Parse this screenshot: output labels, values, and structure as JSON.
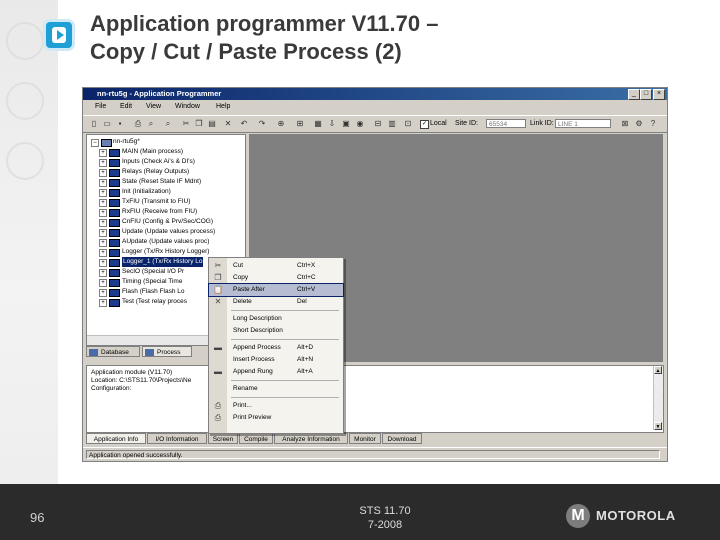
{
  "slide": {
    "title_line1": "Application programmer V11.70 –",
    "title_line2": "Copy / Cut / Paste Process (2)",
    "page_number": "96",
    "footer_line1": "STS 11.70",
    "footer_line2": "7-2008",
    "brand": "MOTOROLA"
  },
  "window": {
    "title": "nn-rtu5g - Application Programmer",
    "menu": [
      "File",
      "Edit",
      "View",
      "Window",
      "Help"
    ],
    "toolbar": {
      "local_label": "Local",
      "local_checked": true,
      "site_id_label": "Site ID:",
      "site_id_value": "65534",
      "link_id_label": "Link ID:",
      "link_id_value": "LINE 1"
    },
    "tree": {
      "root": "nn-rtu5g*",
      "items": [
        "MAIN (Main process)",
        "Inputs (Check Ai's & DI's)",
        "Relays (Relay Outputs)",
        "State (Reset State IF Mdnt)",
        "Init (Initialization)",
        "TxFIU (Transmit to FIU)",
        "RxFIU (Receive from FIU)",
        "CnFIU (Config & Prv/Sec/COG)",
        "Update (Update values process)",
        "AUpdate (Update values proc)",
        "Logger (Tx/Rx History Logger)",
        "Logger_1 (Tx/Rx History Lo",
        "SecIO (Special I/O Pr",
        "Timing (Special Time",
        "Flash (Flash Flash Lo",
        "Test (Test relay proces"
      ],
      "selected_index": 11
    },
    "workspace_tabs": [
      "Database",
      "Process"
    ],
    "output": {
      "lines": [
        "Application module (V11.70)",
        "Location: C:\\STS11.70\\Projects\\Ne",
        "Configuration:"
      ],
      "tabs": [
        "Application Info",
        "I/O Information",
        "Screen",
        "Compile",
        "Analyze Information",
        "Monitor",
        "Download"
      ],
      "active_tab": 0
    },
    "status": "Application opened successfully."
  },
  "context_menu": {
    "items": [
      {
        "label": "Cut",
        "shortcut": "Ctrl+X",
        "icon": "scissors-icon",
        "glyph": "✂"
      },
      {
        "label": "Copy",
        "shortcut": "Ctrl+C",
        "icon": "copy-icon",
        "glyph": "❐"
      },
      {
        "label": "Paste After",
        "shortcut": "Ctrl+V",
        "icon": "paste-icon",
        "glyph": "📋",
        "highlighted": true
      },
      {
        "label": "Delete",
        "shortcut": "Del",
        "icon": "delete-icon",
        "glyph": "✕"
      },
      {
        "sep": true
      },
      {
        "label": "Long Description",
        "shortcut": "",
        "icon": "",
        "glyph": ""
      },
      {
        "label": "Short Description",
        "shortcut": "",
        "icon": "",
        "glyph": ""
      },
      {
        "sep": true
      },
      {
        "label": "Append Process",
        "shortcut": "Alt+D",
        "icon": "append-process-icon",
        "glyph": "▬"
      },
      {
        "label": "Insert Process",
        "shortcut": "Alt+N",
        "icon": "",
        "glyph": ""
      },
      {
        "label": "Append Rung",
        "shortcut": "Alt+A",
        "icon": "append-rung-icon",
        "glyph": "▬"
      },
      {
        "sep": true
      },
      {
        "label": "Rename",
        "shortcut": "",
        "icon": "",
        "glyph": ""
      },
      {
        "sep": true
      },
      {
        "label": "Print...",
        "shortcut": "",
        "icon": "print-icon",
        "glyph": "⎙"
      },
      {
        "label": "Print Preview",
        "shortcut": "",
        "icon": "print-preview-icon",
        "glyph": "⎙"
      }
    ]
  }
}
